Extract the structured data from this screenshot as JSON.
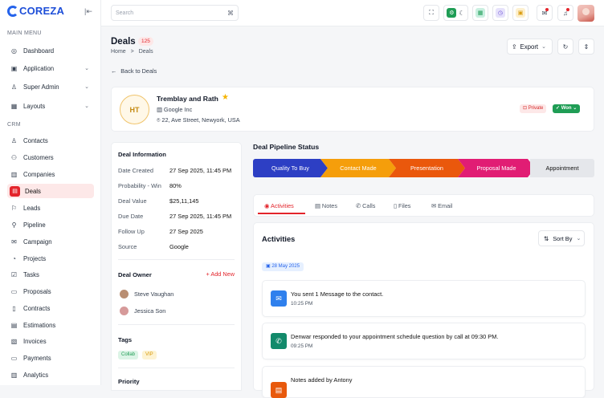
{
  "brand": {
    "name": "COREZA",
    "accent": "#e3242b",
    "logo_color": "#1d4ed8"
  },
  "sidebar": {
    "main_menu_heading": "MAIN MENU",
    "main_items": [
      {
        "label": "Dashboard",
        "icon": "dashboard-icon"
      },
      {
        "label": "Application",
        "icon": "application-icon",
        "has_children": true
      },
      {
        "label": "Super Admin",
        "icon": "user-admin-icon",
        "has_children": true
      },
      {
        "label": "Layouts",
        "icon": "layout-icon",
        "has_children": true
      }
    ],
    "crm_heading": "CRM",
    "crm_items": [
      {
        "label": "Contacts",
        "icon": "contacts-icon"
      },
      {
        "label": "Customers",
        "icon": "customers-icon"
      },
      {
        "label": "Companies",
        "icon": "companies-icon"
      },
      {
        "label": "Deals",
        "icon": "deals-icon",
        "active": true
      },
      {
        "label": "Leads",
        "icon": "leads-icon"
      },
      {
        "label": "Pipeline",
        "icon": "pipeline-icon"
      },
      {
        "label": "Campaign",
        "icon": "campaign-icon"
      },
      {
        "label": "Projects",
        "icon": "projects-icon"
      },
      {
        "label": "Tasks",
        "icon": "tasks-icon"
      },
      {
        "label": "Proposals",
        "icon": "proposals-icon"
      },
      {
        "label": "Contracts",
        "icon": "contracts-icon"
      },
      {
        "label": "Estimations",
        "icon": "estimations-icon"
      },
      {
        "label": "Invoices",
        "icon": "invoices-icon"
      },
      {
        "label": "Payments",
        "icon": "payments-icon"
      },
      {
        "label": "Analytics",
        "icon": "analytics-icon"
      }
    ]
  },
  "topbar": {
    "search_placeholder": "Search",
    "search_shortcut": "⌘"
  },
  "page": {
    "title": "Deals",
    "count": "125",
    "breadcrumb_home": "Home",
    "breadcrumb_sep": ">",
    "breadcrumb_current": "Deals",
    "export_label": "Export",
    "back_label": "Back to Deals"
  },
  "deal": {
    "initials": "HT",
    "name": "Tremblay and Rath",
    "company": "Google Inc",
    "address": "22, Ave Street, Newyork, USA",
    "privacy_badge": "Private",
    "status_badge": "Won"
  },
  "deal_info": {
    "heading": "Deal Information",
    "rows": [
      {
        "key": "Date Created",
        "value": "27 Sep 2025, 11:45 PM"
      },
      {
        "key": "Probability - Win",
        "value": "80%"
      },
      {
        "key": "Deal Value",
        "value": "$25,11,145"
      },
      {
        "key": "Due Date",
        "value": "27 Sep 2025, 11:45 PM"
      },
      {
        "key": "Follow Up",
        "value": "27 Sep 2025"
      },
      {
        "key": "Source",
        "value": "Google"
      }
    ],
    "owner_heading": "Deal Owner",
    "add_new": "+ Add New",
    "owners": [
      "Steve Vaughan",
      "Jessica Son"
    ],
    "tags_heading": "Tags",
    "tags": [
      "Collab",
      "VIP"
    ],
    "priority_heading": "Priority"
  },
  "pipeline": {
    "heading": "Deal Pipeline Status",
    "stages": [
      {
        "label": "Quality To Buy",
        "color": "#2d3fc4"
      },
      {
        "label": "Contact Made",
        "color": "#f59e0b"
      },
      {
        "label": "Presentation",
        "color": "#ea580c"
      },
      {
        "label": "Proposal Made",
        "color": "#e11d74"
      },
      {
        "label": "Appointment",
        "color": "#e5e7eb"
      }
    ]
  },
  "tabs": [
    "Activities",
    "Notes",
    "Calls",
    "Files",
    "Email"
  ],
  "activities": {
    "heading": "Activities",
    "sort_label": "Sort By",
    "date": "28 May 2025",
    "items": [
      {
        "text": "You sent 1 Message to the contact.",
        "time": "10:25 PM",
        "icon": "message-icon",
        "color": "#2f80ed"
      },
      {
        "text": "Denwar responded to your appointment schedule question by call at 09:30 PM.",
        "time": "09:25 PM",
        "icon": "phone-icon",
        "color": "#138a6b"
      },
      {
        "text": "Notes added by Antony",
        "time": "",
        "icon": "note-icon",
        "color": "#e8590c"
      }
    ]
  }
}
